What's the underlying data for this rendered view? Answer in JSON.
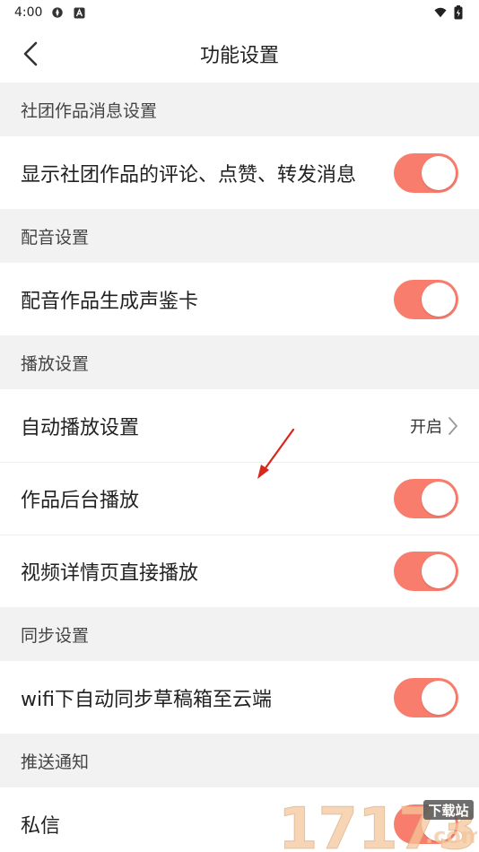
{
  "status": {
    "time": "4:00"
  },
  "nav": {
    "title": "功能设置"
  },
  "sections": {
    "s1": {
      "header": "社团作品消息设置",
      "rows": [
        "显示社团作品的评论、点赞、转发消息"
      ]
    },
    "s2": {
      "header": "配音设置",
      "rows": [
        "配音作品生成声鉴卡"
      ]
    },
    "s3": {
      "header": "播放设置",
      "autoplay_label": "自动播放设置",
      "autoplay_value": "开启",
      "background_label": "作品后台播放",
      "video_label": "视频详情页直接播放"
    },
    "s4": {
      "header": "同步设置",
      "rows": [
        "wifi下自动同步草稿箱至云端"
      ]
    },
    "s5": {
      "header": "推送通知",
      "rows": [
        "私信"
      ]
    }
  },
  "toggles": {
    "community_messages": true,
    "voice_card": true,
    "background_play": true,
    "video_autoplay": true,
    "wifi_sync": true
  },
  "watermark": {
    "text": "17173",
    "badge": "下载站",
    "suffix": ".com"
  },
  "colors": {
    "accent": "#f97d6d",
    "arrow": "#d9261c"
  }
}
